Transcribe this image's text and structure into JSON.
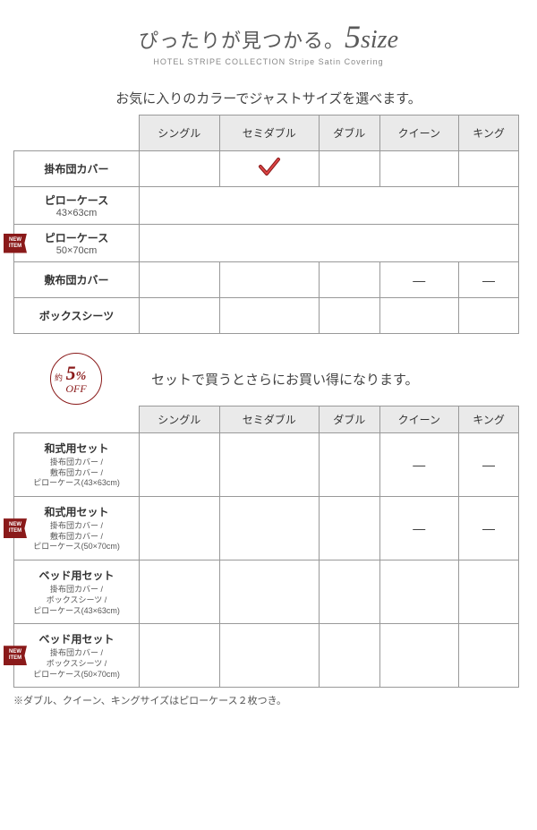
{
  "header": {
    "tagline_pre": "ぴったりが見つかる。",
    "tagline_num": "5",
    "tagline_size": "size",
    "subtitle": "HOTEL STRIPE COLLECTION Stripe Satin Covering"
  },
  "section1": {
    "intro": "お気に入りのカラーでジャストサイズを選べます。",
    "columns": [
      "シングル",
      "セミダブル",
      "ダブル",
      "クイーン",
      "キング"
    ],
    "rows": [
      {
        "label": "掛布団カバー",
        "sub": "",
        "new": false,
        "cells": [
          "",
          "check",
          "",
          "",
          ""
        ]
      },
      {
        "label": "ピローケース",
        "sub": "43×63cm",
        "new": false,
        "cells": [
          "span5"
        ]
      },
      {
        "label": "ピローケース",
        "sub": "50×70cm",
        "new": true,
        "cells": [
          "span5"
        ]
      },
      {
        "label": "敷布団カバー",
        "sub": "",
        "new": false,
        "cells": [
          "",
          "",
          "",
          "—",
          "—"
        ]
      },
      {
        "label": "ボックスシーツ",
        "sub": "",
        "new": false,
        "cells": [
          "",
          "",
          "",
          "",
          ""
        ]
      }
    ]
  },
  "section2": {
    "badge": {
      "yaku": "約",
      "pct": "5",
      "pctmark": "%",
      "off": "OFF"
    },
    "intro": "セットで買うとさらにお買い得になります。",
    "columns": [
      "シングル",
      "セミダブル",
      "ダブル",
      "クイーン",
      "キング"
    ],
    "rows": [
      {
        "title": "和式用セット",
        "details": "掛布団カバー /\n敷布団カバー /\nピローケース(43×63cm)",
        "new": false,
        "cells": [
          "",
          "",
          "",
          "—",
          "—"
        ]
      },
      {
        "title": "和式用セット",
        "details": "掛布団カバー /\n敷布団カバー /\nピローケース(50×70cm)",
        "new": true,
        "cells": [
          "",
          "",
          "",
          "—",
          "—"
        ]
      },
      {
        "title": "ベッド用セット",
        "details": "掛布団カバー /\nボックスシーツ /\nピローケース(43×63cm)",
        "new": false,
        "cells": [
          "",
          "",
          "",
          "",
          ""
        ]
      },
      {
        "title": "ベッド用セット",
        "details": "掛布団カバー /\nボックスシーツ /\nピローケース(50×70cm)",
        "new": true,
        "cells": [
          "",
          "",
          "",
          "",
          ""
        ]
      }
    ],
    "footnote": "※ダブル、クイーン、キングサイズはピローケース２枚つき。"
  },
  "new_badge_text": "NEW\nITEM"
}
